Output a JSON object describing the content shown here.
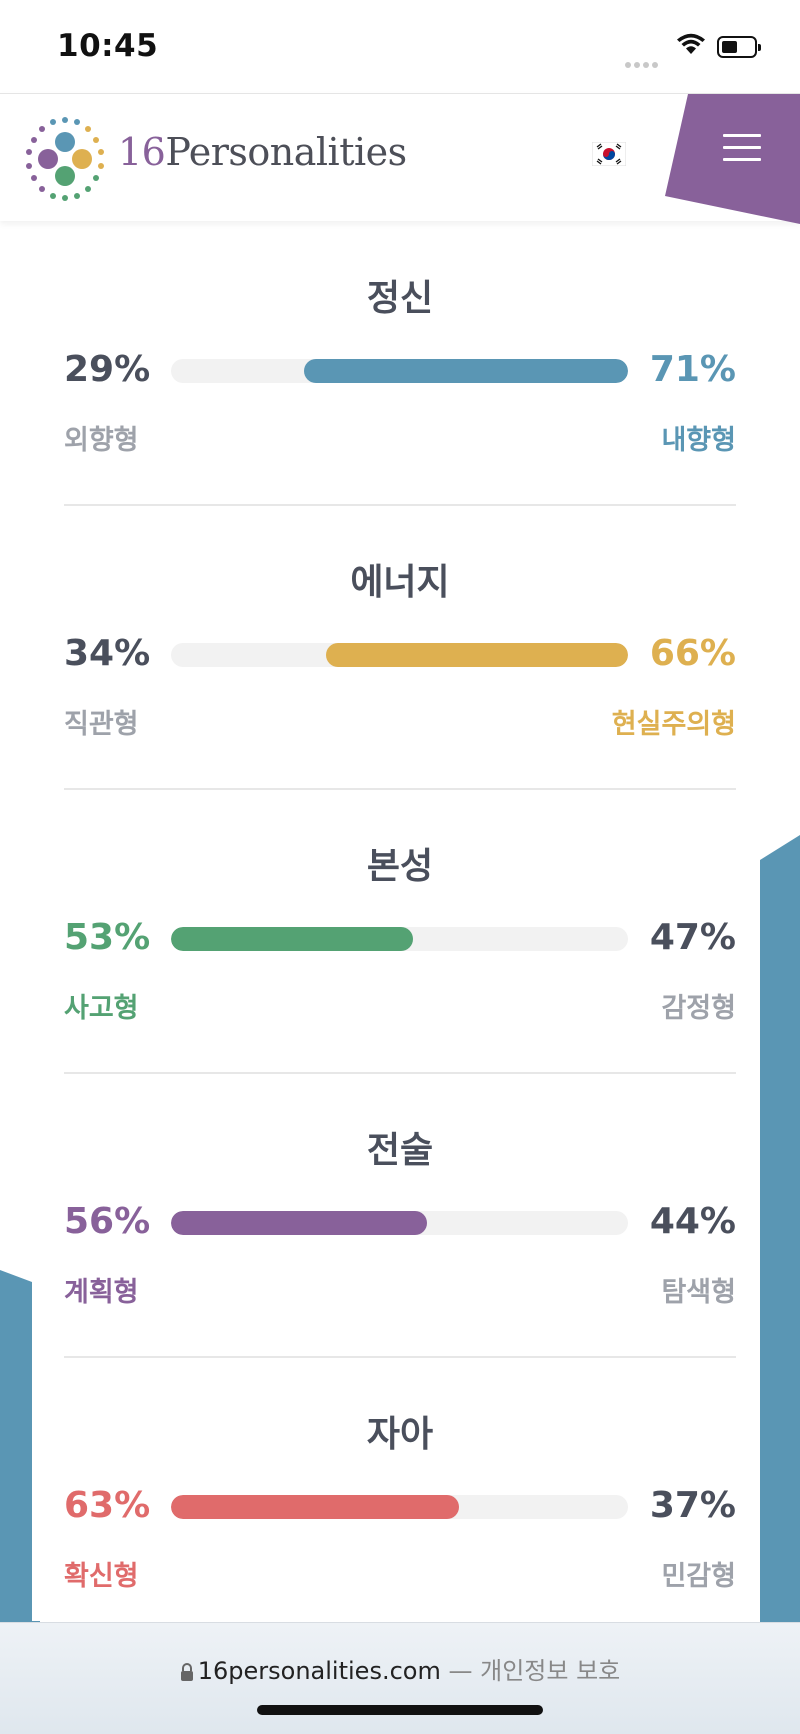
{
  "status_bar": {
    "time": "10:45"
  },
  "header": {
    "logo_number": "16",
    "logo_word": "Personalities"
  },
  "colors": {
    "blue": "#5a96b4",
    "yellow": "#deb050",
    "green": "#54a273",
    "purple": "#88619a",
    "red": "#e06b6b",
    "muted": "#9ea2aa",
    "dark": "#4a4f5c"
  },
  "traits": [
    {
      "title": "정신",
      "left_pct": "29%",
      "right_pct": "71%",
      "left_label": "외향형",
      "right_label": "내향형",
      "dominant": "right",
      "value": 71
    },
    {
      "title": "에너지",
      "left_pct": "34%",
      "right_pct": "66%",
      "left_label": "직관형",
      "right_label": "현실주의형",
      "dominant": "right",
      "value": 66
    },
    {
      "title": "본성",
      "left_pct": "53%",
      "right_pct": "47%",
      "left_label": "사고형",
      "right_label": "감정형",
      "dominant": "left",
      "value": 53
    },
    {
      "title": "전술",
      "left_pct": "56%",
      "right_pct": "44%",
      "left_label": "계획형",
      "right_label": "탐색형",
      "dominant": "left",
      "value": 56
    },
    {
      "title": "자아",
      "left_pct": "63%",
      "right_pct": "37%",
      "left_label": "확신형",
      "right_label": "민감형",
      "dominant": "left",
      "value": 63
    }
  ],
  "browser": {
    "url": "16personalities.com",
    "separator": "—",
    "privacy": "개인정보 보호"
  }
}
